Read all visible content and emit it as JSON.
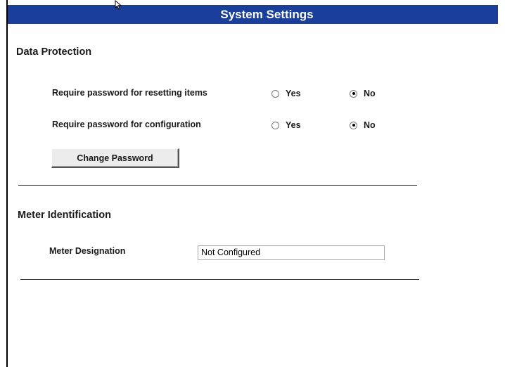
{
  "window": {
    "title": "System Settings"
  },
  "data_protection": {
    "title": "Data Protection",
    "rows": [
      {
        "label": "Require password for resetting items",
        "options": [
          "Yes",
          "No"
        ],
        "selected": "No"
      },
      {
        "label": "Require password for configuration",
        "options": [
          "Yes",
          "No"
        ],
        "selected": "No"
      }
    ],
    "change_password_label": "Change Password"
  },
  "meter_identification": {
    "title": "Meter Identification",
    "designation_label": "Meter Designation",
    "designation_value": "Not Configured"
  },
  "colors": {
    "title_bar": "#1a3f9a",
    "title_text": "#ffffff"
  },
  "icons": {
    "cursor": "mouse-pointer-icon",
    "radio_selected": "radio-checked-icon",
    "radio_unselected": "radio-unchecked-icon"
  }
}
